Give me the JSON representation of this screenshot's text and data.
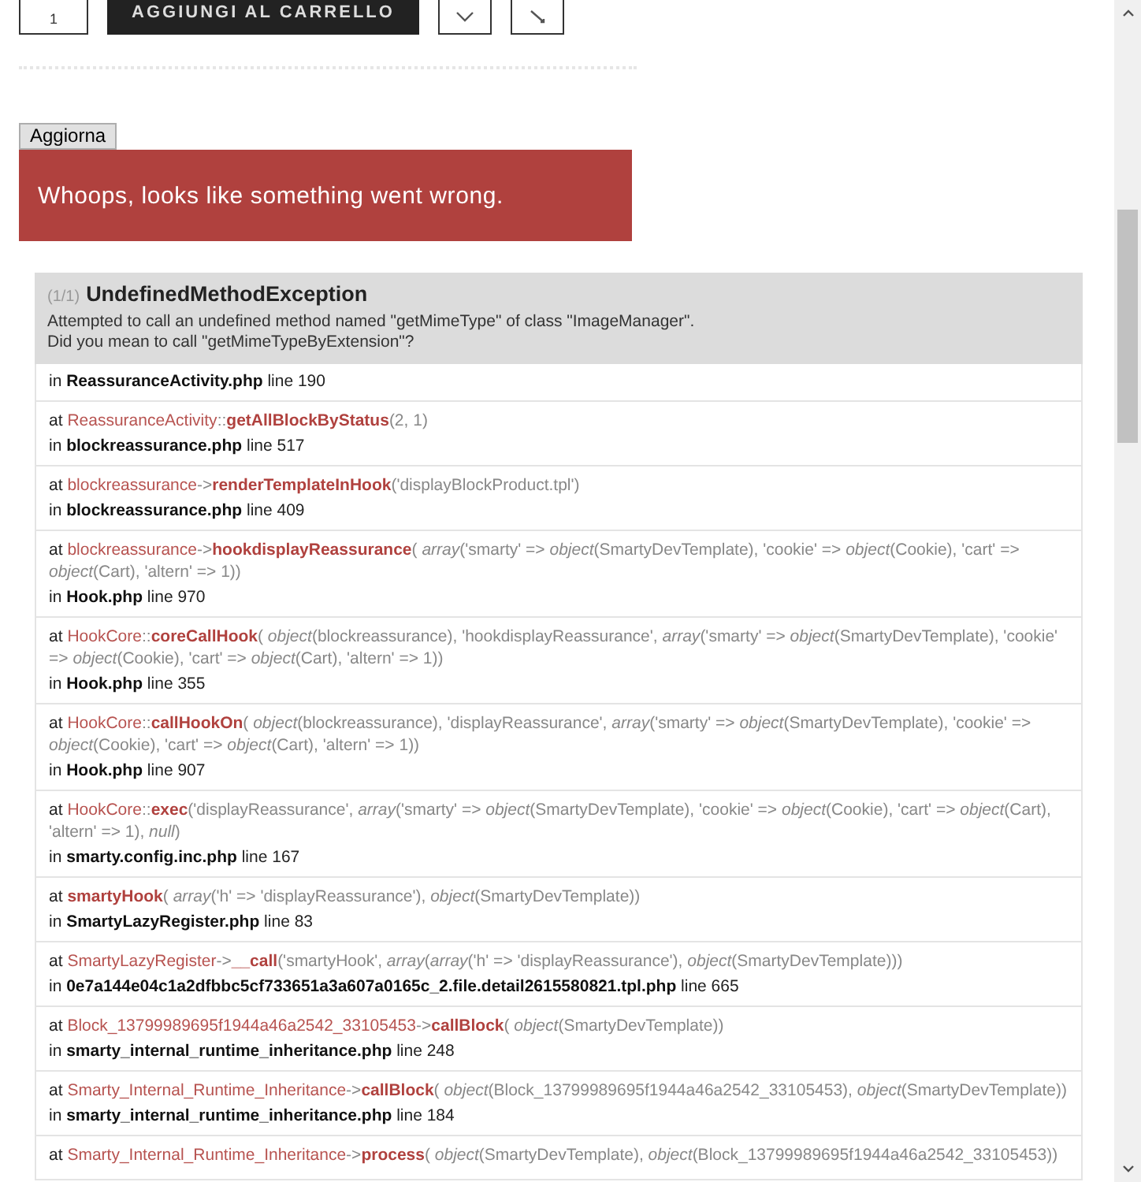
{
  "product_actions": {
    "quantity": "1",
    "add_to_cart": "AGGIUNGI AL CARRELLO"
  },
  "refresh_button": "Aggiorna",
  "error_banner": "Whoops, looks like something went wrong.",
  "exception": {
    "counter": "(1/1)",
    "name": "UndefinedMethodException",
    "message": [
      "Attempted to call an undefined method named \"getMimeType\" of class \"ImageManager\".",
      "Did you mean to call \"getMimeTypeByExtension\"?"
    ],
    "frames": [
      {
        "kind": "location",
        "location": "in **ReassuranceActivity.php** line 190"
      },
      {
        "kind": "call",
        "at": "at",
        "class": "ReassuranceActivity",
        "sep": "::",
        "method": "getAllBlockByStatus",
        "args": "(2, 1)",
        "location": "in **blockreassurance.php** line 517"
      },
      {
        "kind": "call",
        "at": "at",
        "class": "blockreassurance",
        "sep": "->",
        "method": "renderTemplateInHook",
        "args": "('displayBlockProduct.tpl')",
        "location": "in **blockreassurance.php** line 409"
      },
      {
        "kind": "call",
        "at": "at",
        "class": "blockreassurance",
        "sep": "->",
        "method": "hookdisplayReassurance",
        "args": "( *array*('smarty' => *object*(SmartyDevTemplate), 'cookie' => *object*(Cookie), 'cart' => *object*(Cart), 'altern' => 1))",
        "location": "in **Hook.php** line 970"
      },
      {
        "kind": "call",
        "at": "at",
        "class": "HookCore",
        "sep": "::",
        "method": "coreCallHook",
        "args": "( *object*(blockreassurance), 'hookdisplayReassurance', *array*('smarty' => *object*(SmartyDevTemplate), 'cookie' => *object*(Cookie), 'cart' => *object*(Cart), 'altern' => 1))",
        "location": "in **Hook.php** line 355"
      },
      {
        "kind": "call",
        "at": "at",
        "class": "HookCore",
        "sep": "::",
        "method": "callHookOn",
        "args": "( *object*(blockreassurance), 'displayReassurance', *array*('smarty' => *object*(SmartyDevTemplate), 'cookie' => *object*(Cookie), 'cart' => *object*(Cart), 'altern' => 1))",
        "location": "in **Hook.php** line 907"
      },
      {
        "kind": "call",
        "at": "at",
        "class": "HookCore",
        "sep": "::",
        "method": "exec",
        "args": "('displayReassurance', *array*('smarty' => *object*(SmartyDevTemplate), 'cookie' => *object*(Cookie), 'cart' => *object*(Cart), 'altern' => 1), *null*)",
        "location": "in **smarty.config.inc.php** line 167"
      },
      {
        "kind": "call",
        "at": "at",
        "method": "smartyHook",
        "args": "( *array*('h' => 'displayReassurance'), *object*(SmartyDevTemplate))",
        "location": "in **SmartyLazyRegister.php** line 83"
      },
      {
        "kind": "call",
        "at": "at",
        "class": "SmartyLazyRegister",
        "sep": "->",
        "method": "__call",
        "args": "('smartyHook', *array*(*array*('h' => 'displayReassurance'), *object*(SmartyDevTemplate)))",
        "location": "in **0e7a144e04c1a2dfbbc5cf733651a3a607a0165c_2.file.detail2615580821.tpl.php** line 665"
      },
      {
        "kind": "call",
        "at": "at",
        "class": "Block_13799989695f1944a46a2542_33105453",
        "sep": "->",
        "method": "callBlock",
        "args": "( *object*(SmartyDevTemplate))",
        "location": "in **smarty_internal_runtime_inheritance.php** line 248"
      },
      {
        "kind": "call",
        "at": "at",
        "class": "Smarty_Internal_Runtime_Inheritance",
        "sep": "->",
        "method": "callBlock",
        "args": "( *object*(Block_13799989695f1944a46a2542_33105453), *object*(SmartyDevTemplate))",
        "location": "in **smarty_internal_runtime_inheritance.php** line 184"
      },
      {
        "kind": "call",
        "at": "at",
        "class": "Smarty_Internal_Runtime_Inheritance",
        "sep": "->",
        "method": "process",
        "args": "( *object*(SmartyDevTemplate), *object*(Block_13799989695f1944a46a2542_33105453))"
      }
    ]
  }
}
